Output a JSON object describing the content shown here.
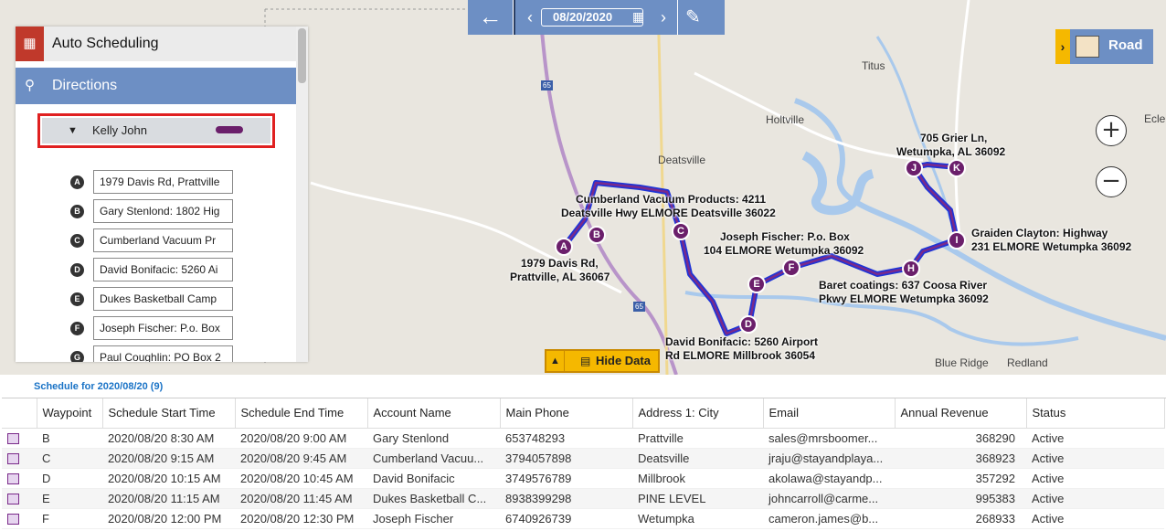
{
  "toolbar": {
    "date": "08/20/2020",
    "back_icon": "arrow-left-icon",
    "calendar_icon": "calendar-icon",
    "notes_icon": "clipboard-edit-icon"
  },
  "map_view": {
    "label": "Road"
  },
  "places": {
    "titus": "Titus",
    "holtville": "Holtville",
    "deatsville": "Deatsville",
    "blue_ridge": "Blue Ridge",
    "redland": "Redland",
    "ecle": "Ecle",
    "hwy65a": "65",
    "hwy65b": "65"
  },
  "route_labels": {
    "a": [
      "1979 Davis Rd,",
      "Prattville, AL 36067"
    ],
    "c": [
      "Cumberland Vacuum Products: 4211",
      "Deatsville Hwy ELMORE Deatsville 36022"
    ],
    "f": [
      "Joseph Fischer: P.o. Box",
      "104 ELMORE Wetumpka 36092"
    ],
    "h": [
      "Baret coatings: 637 Coosa River",
      "Pkwy ELMORE Wetumpka 36092"
    ],
    "d": [
      "David Bonifacic: 5260 Airport",
      "Rd ELMORE Millbrook 36054"
    ],
    "i": [
      "Graiden Clayton: Highway",
      "231 ELMORE Wetumpka 36092"
    ],
    "k": [
      "705 Grier Ln,",
      "Wetumpka, AL 36092"
    ]
  },
  "waypoints": [
    "A",
    "B",
    "C",
    "D",
    "E",
    "F",
    "H",
    "I",
    "J",
    "K"
  ],
  "panel": {
    "auto_scheduling": "Auto Scheduling",
    "directions": "Directions",
    "driver": "Kelly John",
    "route_color": "#6b1f6b",
    "stops": [
      {
        "letter": "A",
        "address": "1979 Davis Rd, Prattville"
      },
      {
        "letter": "B",
        "address": "Gary Stenlond: 1802 Hig"
      },
      {
        "letter": "C",
        "address": "Cumberland Vacuum Pr"
      },
      {
        "letter": "D",
        "address": "David Bonifacic: 5260 Ai"
      },
      {
        "letter": "E",
        "address": "Dukes Basketball Camp"
      },
      {
        "letter": "F",
        "address": "Joseph Fischer: P.o. Box"
      },
      {
        "letter": "G",
        "address": "Paul Coughlin: PO Box 2"
      }
    ]
  },
  "hide_data": "Hide Data",
  "schedule": {
    "title": "Schedule for 2020/08/20 (9)",
    "columns": [
      "Waypoint",
      "Schedule Start Time",
      "Schedule End Time",
      "Account Name",
      "Main Phone",
      "Address 1: City",
      "Email",
      "Annual Revenue",
      "Status"
    ],
    "rows": [
      [
        "B",
        "2020/08/20 8:30 AM",
        "2020/08/20 9:00 AM",
        "Gary Stenlond",
        "653748293",
        "Prattville",
        "sales@mrsboomer...",
        "368290",
        "Active"
      ],
      [
        "C",
        "2020/08/20 9:15 AM",
        "2020/08/20 9:45 AM",
        "Cumberland Vacuu...",
        "3794057898",
        "Deatsville",
        "jraju@stayandplaya...",
        "368923",
        "Active"
      ],
      [
        "D",
        "2020/08/20 10:15 AM",
        "2020/08/20 10:45 AM",
        "David Bonifacic",
        "3749576789",
        "Millbrook",
        "akolawa@stayandp...",
        "357292",
        "Active"
      ],
      [
        "E",
        "2020/08/20 11:15 AM",
        "2020/08/20 11:45 AM",
        "Dukes Basketball C...",
        "8938399298",
        "PINE LEVEL",
        "johncarroll@carme...",
        "995383",
        "Active"
      ],
      [
        "F",
        "2020/08/20 12:00 PM",
        "2020/08/20 12:30 PM",
        "Joseph Fischer",
        "6740926739",
        "Wetumpka",
        "cameron.james@b...",
        "268933",
        "Active"
      ]
    ]
  }
}
